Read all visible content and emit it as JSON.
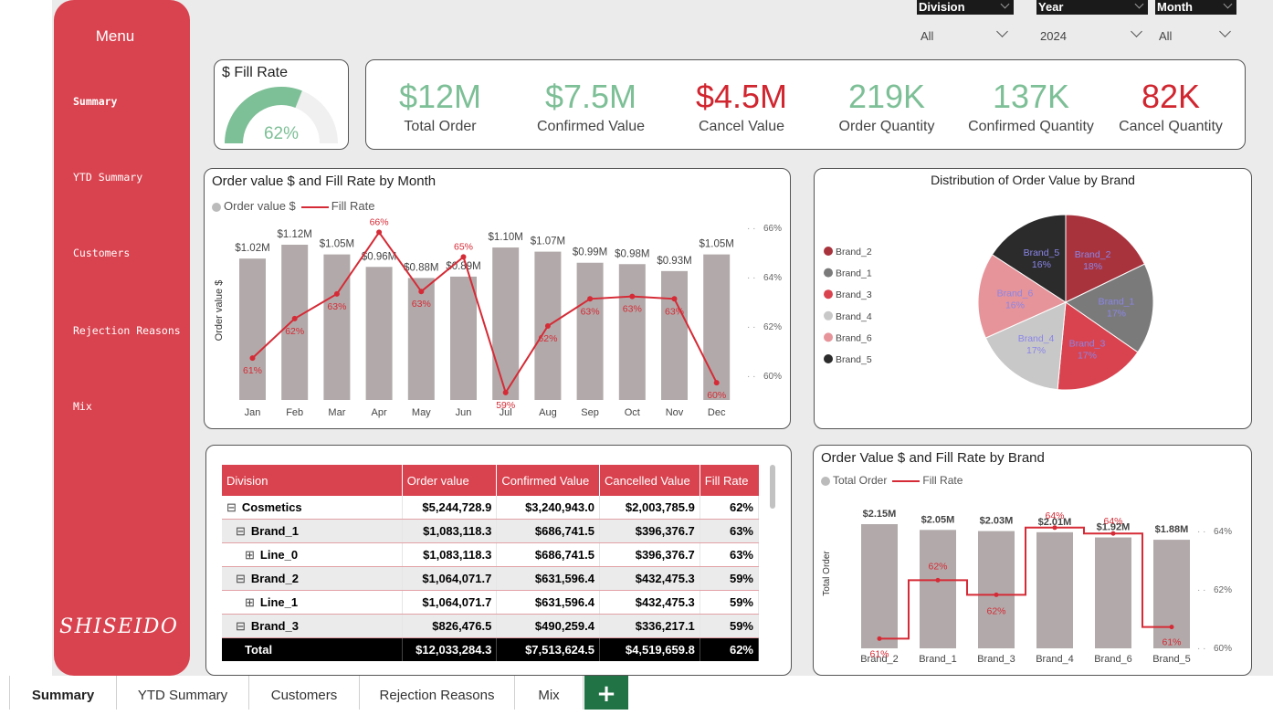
{
  "sidebar": {
    "title": "Menu",
    "items": [
      {
        "label": "Summary"
      },
      {
        "label": "YTD Summary"
      },
      {
        "label": "Customers"
      },
      {
        "label": "Rejection Reasons"
      },
      {
        "label": "Mix"
      }
    ],
    "logo": "SHISEIDO"
  },
  "filters": [
    {
      "label": "Division",
      "value": "All"
    },
    {
      "label": "Year",
      "value": "2024"
    },
    {
      "label": "Month",
      "value": "All"
    }
  ],
  "fill_rate_card": {
    "title": "$ Fill Rate",
    "value": "62%",
    "fraction": 0.62
  },
  "kpis": [
    {
      "value": "$12M",
      "label": "Total Order",
      "color": "#7dbf96"
    },
    {
      "value": "$7.5M",
      "label": "Confirmed Value",
      "color": "#7dbf96"
    },
    {
      "value": "$4.5M",
      "label": "Cancel Value",
      "color": "#d12630"
    },
    {
      "value": "219K",
      "label": "Order Quantity",
      "color": "#7dbf96"
    },
    {
      "value": "137K",
      "label": "Confirmed Quantity",
      "color": "#7dbf96"
    },
    {
      "value": "82K",
      "label": "Cancel Quantity",
      "color": "#d12630"
    }
  ],
  "month_chart": {
    "title": "Order value $ and Fill Rate by Month",
    "legend_bar": "Order value $",
    "legend_line": "Fill Rate",
    "ylabel": "Order value $"
  },
  "pie_chart": {
    "title": "Distribution of Order Value by Brand"
  },
  "brand_chart": {
    "title": "Order Value $ and Fill Rate by Brand",
    "legend_bar": "Total Order",
    "legend_line": "Fill Rate",
    "ylabel": "Total Order"
  },
  "table": {
    "headers": [
      "Division",
      "Order value",
      "Confirmed Value",
      "Cancelled Value",
      "Fill Rate"
    ],
    "rows": [
      {
        "name": "Cosmetics",
        "level": 0,
        "toggle": "⊟",
        "order": "$5,244,728.9",
        "confirmed": "$3,240,943.0",
        "cancelled": "$2,003,785.9",
        "fill": "62%"
      },
      {
        "name": "Brand_1",
        "level": 1,
        "toggle": "⊟",
        "order": "$1,083,118.3",
        "confirmed": "$686,741.5",
        "cancelled": "$396,376.7",
        "fill": "63%"
      },
      {
        "name": "Line_0",
        "level": 2,
        "toggle": "⊞",
        "order": "$1,083,118.3",
        "confirmed": "$686,741.5",
        "cancelled": "$396,376.7",
        "fill": "63%"
      },
      {
        "name": "Brand_2",
        "level": 1,
        "toggle": "⊟",
        "order": "$1,064,071.7",
        "confirmed": "$631,596.4",
        "cancelled": "$432,475.3",
        "fill": "59%"
      },
      {
        "name": "Line_1",
        "level": 2,
        "toggle": "⊞",
        "order": "$1,064,071.7",
        "confirmed": "$631,596.4",
        "cancelled": "$432,475.3",
        "fill": "59%"
      },
      {
        "name": "Brand_3",
        "level": 1,
        "toggle": "⊟",
        "order": "$826,476.5",
        "confirmed": "$490,259.4",
        "cancelled": "$336,217.1",
        "fill": "59%"
      }
    ],
    "total": {
      "name": "Total",
      "order": "$12,033,284.3",
      "confirmed": "$7,513,624.5",
      "cancelled": "$4,519,659.8",
      "fill": "62%"
    }
  },
  "tabs": [
    {
      "label": "Summary",
      "active": true
    },
    {
      "label": "YTD Summary"
    },
    {
      "label": "Customers"
    },
    {
      "label": "Rejection Reasons"
    },
    {
      "label": "Mix"
    }
  ],
  "add_tab": "+",
  "colors": {
    "accent": "#d9434f",
    "line": "#d52b36",
    "bar": "#b2aaaa",
    "positive": "#7dbf96",
    "negative": "#d12630"
  },
  "chart_data": [
    {
      "type": "bar",
      "title": "Order value $ and Fill Rate by Month",
      "ylabel": "Order value $",
      "categories": [
        "Jan",
        "Feb",
        "Mar",
        "Apr",
        "May",
        "Jun",
        "Jul",
        "Aug",
        "Sep",
        "Oct",
        "Nov",
        "Dec"
      ],
      "series": [
        {
          "name": "Order value $",
          "type": "bar",
          "values": [
            1.02,
            1.12,
            1.05,
            0.96,
            0.88,
            0.89,
            1.1,
            1.07,
            0.99,
            0.98,
            0.93,
            1.05
          ],
          "labels": [
            "$1.02M",
            "$1.12M",
            "$1.05M",
            "$0.96M",
            "$0.88M",
            "$0.89M",
            "$1.10M",
            "$1.07M",
            "$0.99M",
            "$0.98M",
            "$0.93M",
            "$1.05M"
          ]
        },
        {
          "name": "Fill Rate",
          "type": "line",
          "values": [
            60.7,
            62.3,
            63.3,
            65.8,
            63.4,
            64.8,
            59.3,
            62.0,
            63.1,
            63.2,
            63.1,
            59.7
          ],
          "labels": [
            "61%",
            "62%",
            "63%",
            "66%",
            "63%",
            "65%",
            "59%",
            "62%",
            "63%",
            "63%",
            "63%",
            "60%"
          ]
        }
      ],
      "y2_ticks": [
        "66%",
        "64%",
        "62%",
        "60%"
      ],
      "y2_range": [
        59,
        66.5
      ]
    },
    {
      "type": "pie",
      "title": "Distribution of Order Value by Brand",
      "legend": [
        "Brand_2",
        "Brand_1",
        "Brand_3",
        "Brand_4",
        "Brand_6",
        "Brand_5"
      ],
      "slices": [
        {
          "name": "Brand_2",
          "value": 18,
          "label": "18%",
          "color": "#a8333d"
        },
        {
          "name": "Brand_1",
          "value": 17,
          "label": "17%",
          "color": "#7a7a7a"
        },
        {
          "name": "Brand_3",
          "value": 17,
          "label": "17%",
          "color": "#d9434f"
        },
        {
          "name": "Brand_4",
          "value": 17,
          "label": "17%",
          "color": "#c8c8c8"
        },
        {
          "name": "Brand_6",
          "value": 16,
          "label": "16%",
          "color": "#e6949a"
        },
        {
          "name": "Brand_5",
          "value": 16,
          "label": "16%",
          "color": "#2b2b2b"
        }
      ]
    },
    {
      "type": "bar",
      "title": "Order Value $ and Fill Rate by Brand",
      "ylabel": "Total Order",
      "categories": [
        "Brand_2",
        "Brand_1",
        "Brand_3",
        "Brand_4",
        "Brand_6",
        "Brand_5"
      ],
      "series": [
        {
          "name": "Total Order",
          "type": "bar",
          "values": [
            2.15,
            2.05,
            2.03,
            2.01,
            1.92,
            1.88
          ],
          "labels": [
            "$2.15M",
            "$2.05M",
            "$2.03M",
            "$2.01M",
            "$1.92M",
            "$1.88M"
          ]
        },
        {
          "name": "Fill Rate",
          "type": "line",
          "values": [
            60.3,
            62.3,
            61.8,
            64.1,
            63.9,
            60.7
          ],
          "labels": [
            "61%",
            "62%",
            "62%",
            "64%",
            "64%",
            "61%"
          ]
        }
      ],
      "y2_ticks": [
        "64%",
        "62%",
        "60%"
      ],
      "y2_range": [
        59.5,
        65.5
      ]
    }
  ]
}
